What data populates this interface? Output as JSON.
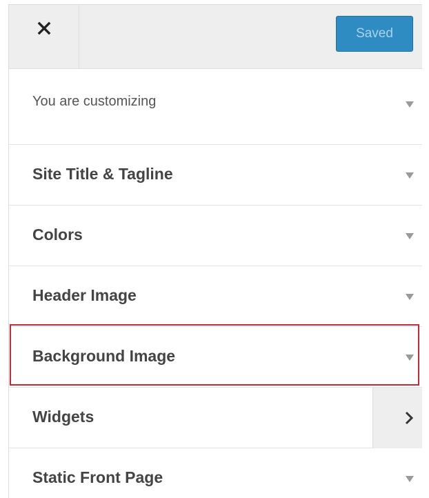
{
  "header": {
    "close_icon": "close-icon",
    "saved_label": "Saved",
    "saved_color": "#2e8cc3"
  },
  "intro": {
    "label": "You are customizing",
    "icon": "caret-down-icon"
  },
  "sections": [
    {
      "label": "Site Title & Tagline",
      "icon": "caret-down-icon"
    },
    {
      "label": "Colors",
      "icon": "caret-down-icon"
    },
    {
      "label": "Header Image",
      "icon": "caret-down-icon"
    },
    {
      "label": "Background Image",
      "icon": "caret-down-icon",
      "highlighted": true,
      "highlight_color": "#c8283a"
    },
    {
      "label": "Widgets",
      "icon": "chevron-right-icon"
    },
    {
      "label": "Static Front Page",
      "icon": "caret-down-icon"
    }
  ]
}
